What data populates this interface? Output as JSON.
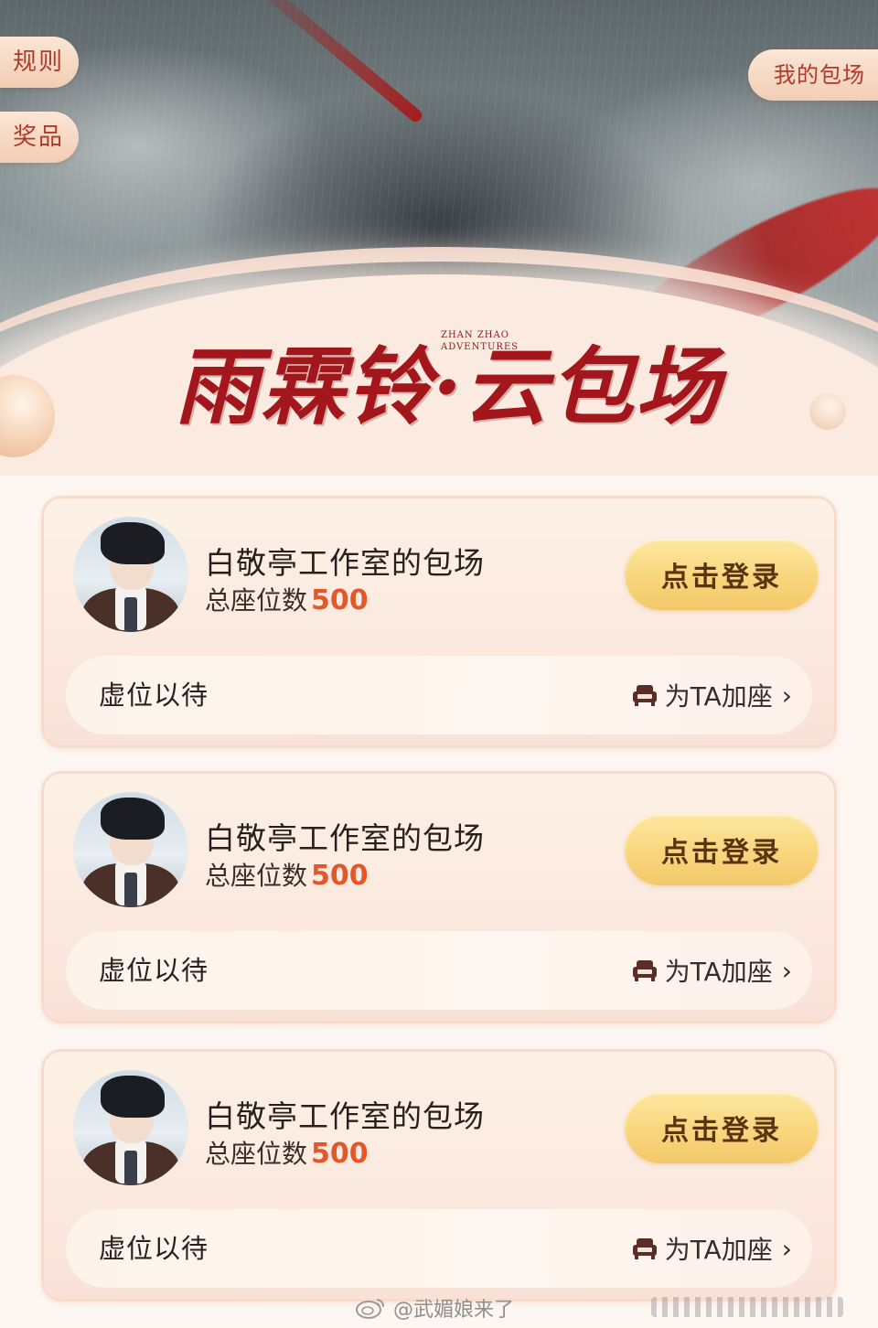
{
  "header": {
    "rules_label": "规则",
    "prizes_label": "奖品",
    "my_booking_label": "我的包场",
    "title": "雨霖铃·云包场",
    "subtitle_en_line1": "ZHAN ZHAO",
    "subtitle_en_line2": "ADVENTURES"
  },
  "cards": [
    {
      "name": "白敬亭工作室的包场",
      "seats_label": "总座位数",
      "seats_value": "500",
      "login_label": "点击登录",
      "waiting_label": "虚位以待",
      "add_seat_label": "为TA加座"
    },
    {
      "name": "白敬亭工作室的包场",
      "seats_label": "总座位数",
      "seats_value": "500",
      "login_label": "点击登录",
      "waiting_label": "虚位以待",
      "add_seat_label": "为TA加座"
    },
    {
      "name": "白敬亭工作室的包场",
      "seats_label": "总座位数",
      "seats_value": "500",
      "login_label": "点击登录",
      "waiting_label": "虚位以待",
      "add_seat_label": "为TA加座"
    }
  ],
  "watermark": {
    "text": "@武媚娘来了",
    "icon": "weibo-icon"
  },
  "icons": {
    "seat": "sofa-seat-icon",
    "chevron": "chevron-right-icon"
  },
  "colors": {
    "accent_red": "#a3161b",
    "seat_count": "#e3572b",
    "button_gold": "#f8d47a",
    "pill_text": "#b03a2a"
  }
}
